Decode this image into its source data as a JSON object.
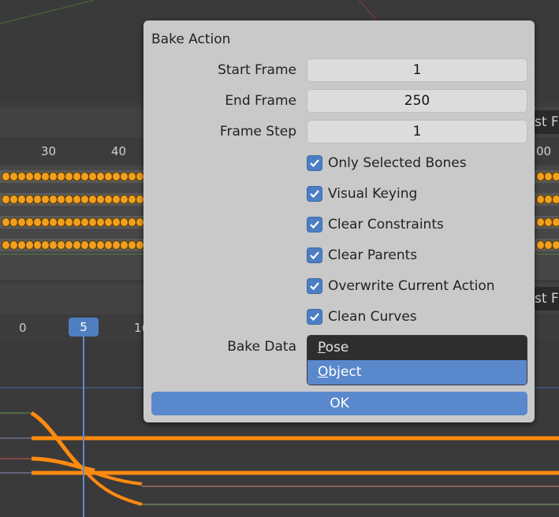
{
  "dialog": {
    "title": "Bake Action",
    "start_frame_label": "Start Frame",
    "start_frame_value": "1",
    "end_frame_label": "End Frame",
    "end_frame_value": "250",
    "frame_step_label": "Frame Step",
    "frame_step_value": "1",
    "options": [
      {
        "label": "Only Selected Bones",
        "checked": true
      },
      {
        "label": "Visual Keying",
        "checked": true
      },
      {
        "label": "Clear Constraints",
        "checked": true
      },
      {
        "label": "Clear Parents",
        "checked": true
      },
      {
        "label": "Overwrite Current Action",
        "checked": true
      },
      {
        "label": "Clean Curves",
        "checked": true
      }
    ],
    "bake_data_label": "Bake Data",
    "bake_data_options": {
      "pose": {
        "first": "P",
        "rest": "ose"
      },
      "object": {
        "first": "O",
        "rest": "bject"
      }
    },
    "ok": {
      "first": "OK"
    }
  },
  "background": {
    "ruler1": [
      "30",
      "40",
      "00"
    ],
    "ruler2": [
      "0",
      "5",
      "1("
    ],
    "side_button_1": "st F",
    "side_button_2": "st F",
    "current_frame": "5"
  },
  "colors": {
    "accent": "#5a88cc",
    "keyframe": "#f0a020",
    "dialog_bg": "#c9c9c9"
  }
}
